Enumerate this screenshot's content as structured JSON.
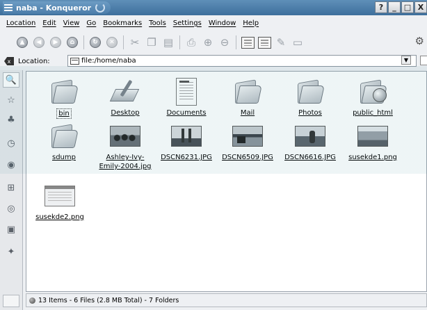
{
  "window": {
    "title": "naba - Konqueror",
    "buttons": [
      "?",
      "_",
      "□",
      "X"
    ]
  },
  "menubar": {
    "items": [
      "Location",
      "Edit",
      "View",
      "Go",
      "Bookmarks",
      "Tools",
      "Settings",
      "Window",
      "Help"
    ]
  },
  "toolbar": {
    "icons": [
      "up-icon",
      "back-icon",
      "forward-icon",
      "home-icon",
      "reload-icon",
      "stop-icon",
      "cut-icon",
      "copy-icon",
      "paste-icon",
      "print-icon",
      "zoom-in-icon",
      "zoom-out-icon",
      "icon-view-icon",
      "detail-view-icon",
      "pen-icon",
      "terminal-icon"
    ]
  },
  "location": {
    "label": "Location:",
    "value": "file:/home/naba"
  },
  "sidebar": {
    "icons": [
      "navigation-icon",
      "bookmarks-icon",
      "network-icon",
      "history-icon",
      "devices-icon",
      "services-icon",
      "remote-icon",
      "home-folder-icon",
      "root-folder-icon"
    ]
  },
  "files": [
    {
      "name": "bin",
      "type": "folder"
    },
    {
      "name": "Desktop",
      "type": "desktop"
    },
    {
      "name": "Documents",
      "type": "document"
    },
    {
      "name": "Mail",
      "type": "folder"
    },
    {
      "name": "Photos",
      "type": "folder"
    },
    {
      "name": "public_html",
      "type": "web-folder"
    },
    {
      "name": "sdump",
      "type": "folder"
    },
    {
      "name": "Ashley-Ivy-\nEmily-2004.jpg",
      "label1": "Ashley-Ivy-",
      "label2": "Emily-2004.jpg",
      "type": "photo"
    },
    {
      "name": "DSCN6231.JPG",
      "type": "photo"
    },
    {
      "name": "DSCN6509.JPG",
      "type": "photo"
    },
    {
      "name": "DSCN6616.JPG",
      "type": "photo"
    },
    {
      "name": "susekde1.png",
      "type": "photo"
    },
    {
      "name": "susekde2.png",
      "type": "screenshot"
    }
  ],
  "status": {
    "text": "13 Items - 6 Files (2.8 MB Total) - 7 Folders"
  }
}
